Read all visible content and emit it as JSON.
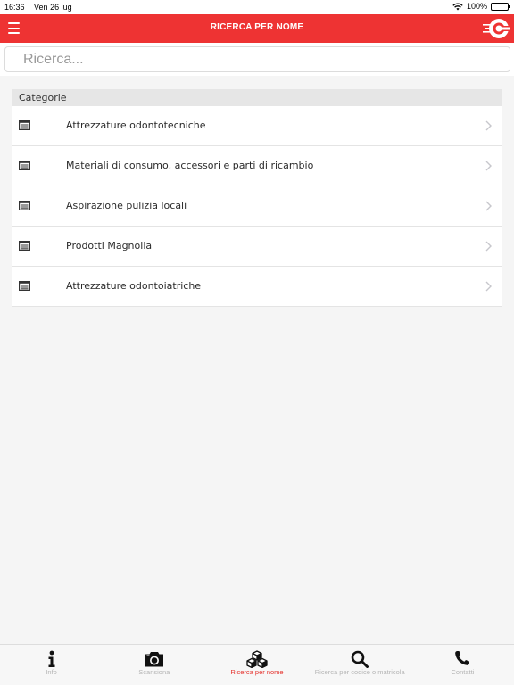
{
  "status_bar": {
    "time": "16:36",
    "date": "Ven 26 lug",
    "battery": "100%"
  },
  "nav": {
    "title": "RICERCA PER NOME",
    "icons": {
      "menu": "hamburger-icon",
      "logo": "brand-logo"
    }
  },
  "search": {
    "placeholder": "Ricerca...",
    "value": ""
  },
  "section": {
    "title": "Categorie"
  },
  "categories": [
    {
      "label": "Attrezzature odontotecniche",
      "icon": "list-icon"
    },
    {
      "label": "Materiali di consumo, accessori e parti di ricambio",
      "icon": "list-icon"
    },
    {
      "label": "Aspirazione pulizia locali",
      "icon": "list-icon"
    },
    {
      "label": "Prodotti Magnolia",
      "icon": "list-icon"
    },
    {
      "label": "Attrezzature odontoiatriche",
      "icon": "list-icon"
    }
  ],
  "tabs": [
    {
      "label": "Info",
      "icon": "info-icon",
      "active": false
    },
    {
      "label": "Scansiona",
      "icon": "camera-icon",
      "active": false
    },
    {
      "label": "Ricerca per nome",
      "icon": "boxes-icon",
      "active": true
    },
    {
      "label": "Ricerca per codice o matricola",
      "icon": "search-icon",
      "active": false
    },
    {
      "label": "Contatti",
      "icon": "phone-icon",
      "active": false
    }
  ],
  "colors": {
    "accent": "#ee3333",
    "active_tab": "#e5322d",
    "inactive_tab": "#b5b5b5"
  }
}
